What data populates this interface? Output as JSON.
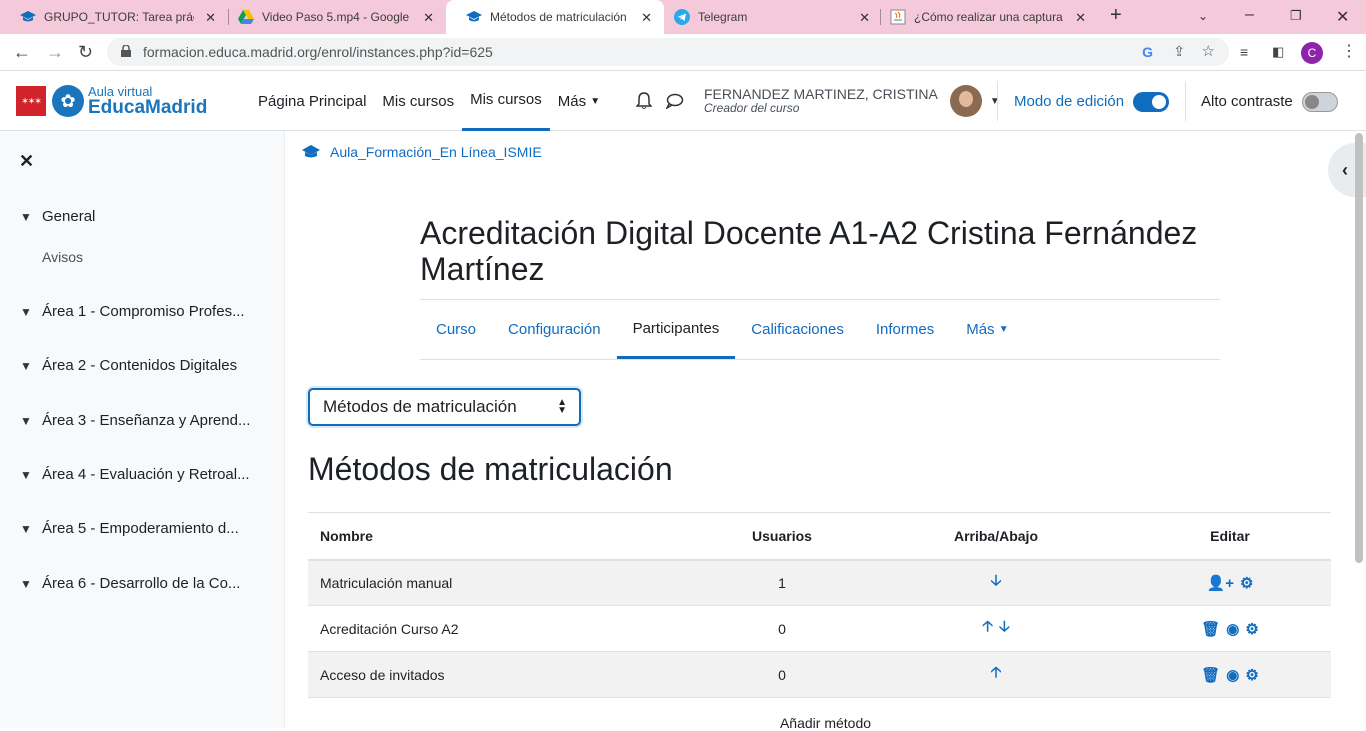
{
  "browser": {
    "tabs": [
      {
        "title": "GRUPO_TUTOR: Tarea práctic",
        "icon": "mortarboard-icon"
      },
      {
        "title": "Video Paso 5.mp4 - Google D",
        "icon": "google-drive-icon"
      },
      {
        "title": "Métodos de matriculación",
        "icon": "mortarboard-icon"
      },
      {
        "title": "Telegram",
        "icon": "telegram-icon"
      },
      {
        "title": "¿Cómo realizar una captura d",
        "icon": "java-icon"
      }
    ],
    "url": "formacion.educa.madrid.org/enrol/instances.php?id=625",
    "profile_initial": "C"
  },
  "header": {
    "brand_line1": "Aula virtual",
    "brand_line2": "EducaMadrid",
    "nav": [
      "Página Principal",
      "Mis cursos",
      "Mis cursos",
      "Más"
    ],
    "user_name": "FERNANDEZ MARTINEZ, CRISTINA",
    "user_role": "Creador del curso",
    "edit_mode_label": "Modo de edición",
    "contrast_label": "Alto contraste"
  },
  "drawer": {
    "sections": [
      {
        "label": "General",
        "subitems": [
          "Avisos"
        ]
      },
      {
        "label": "Área 1 - Compromiso Profes..."
      },
      {
        "label": "Área 2 - Contenidos Digitales"
      },
      {
        "label": "Área 3 - Enseñanza y Aprend..."
      },
      {
        "label": "Área 4 - Evaluación y Retroal..."
      },
      {
        "label": "Área 5 - Empoderamiento d..."
      },
      {
        "label": "Área 6 - Desarrollo de la Co..."
      }
    ]
  },
  "main": {
    "breadcrumb": "Aula_Formación_En Línea_ISMIE",
    "course_title": "Acreditación Digital Docente A1-A2 Cristina Fernández Martínez",
    "secondary_nav": [
      "Curso",
      "Configuración",
      "Participantes",
      "Calificaciones",
      "Informes",
      "Más"
    ],
    "select_value": "Métodos de matriculación",
    "heading": "Métodos de matriculación",
    "table": {
      "headers": [
        "Nombre",
        "Usuarios",
        "Arriba/Abajo",
        "Editar"
      ],
      "rows": [
        {
          "name": "Matriculación manual",
          "users": "1"
        },
        {
          "name": "Acreditación Curso A2",
          "users": "0"
        },
        {
          "name": "Acceso de invitados",
          "users": "0"
        }
      ]
    },
    "add_method": "Añadir método"
  },
  "colors": {
    "accent": "#0f6cbf",
    "tabbar": "#f4c9d9"
  }
}
